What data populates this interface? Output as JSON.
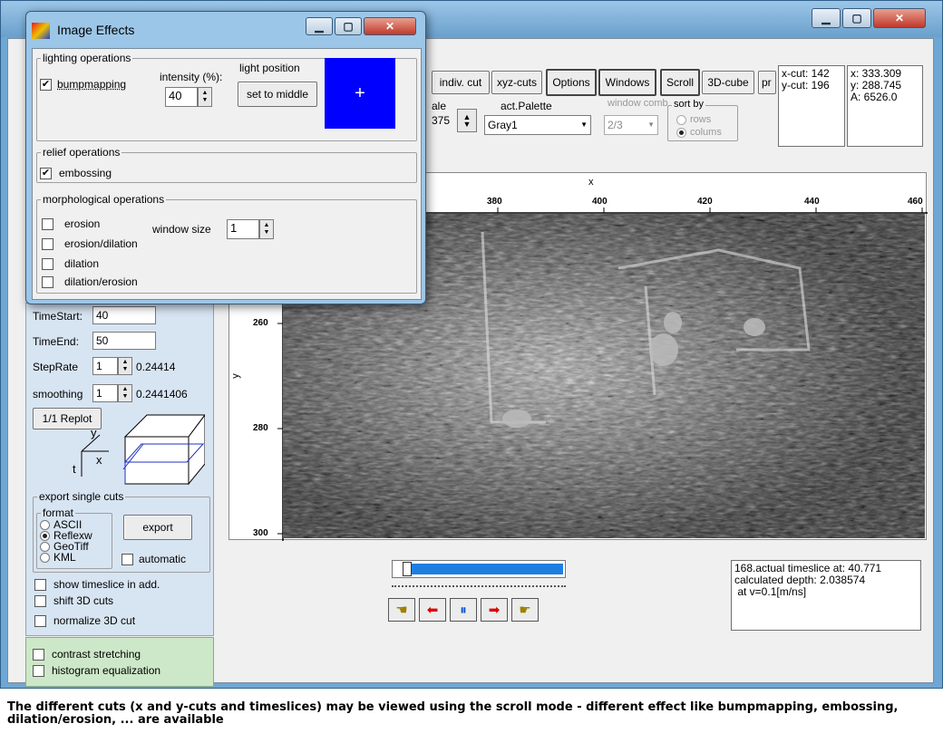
{
  "toolbar": {
    "indiv_cut": "indiv. cut",
    "xyz_cuts": "xyz-cuts",
    "options": "Options",
    "windows": "Windows",
    "scroll": "Scroll",
    "cube3d": "3D-cube",
    "pr_partial": "pr",
    "scale_label_partial": "ale",
    "scale_value_partial": "375",
    "palette_label": "act.Palette",
    "palette_value": "Gray1",
    "window_comb_label": "window comb.",
    "window_comb_value": "2/3",
    "sort_by_label": "sort by",
    "sort_rows": "rows",
    "sort_columns": "colums"
  },
  "info1": "x-cut: 142\ny-cut: 196",
  "info2": "x: 333.309\ny: 288.745\nA: 6526.0",
  "plot": {
    "x_axis_label": "x",
    "y_axis_label": "y",
    "x_ticks": [
      "380",
      "400",
      "420",
      "440",
      "460"
    ],
    "y_ticks": [
      "260",
      "280",
      "300"
    ]
  },
  "left_panel": {
    "time_start_label": "TimeStart:",
    "time_start_value": "40",
    "time_end_label": "TimeEnd:",
    "time_end_value": "50",
    "step_rate_label": "StepRate",
    "step_rate_value": "1",
    "step_rate_extra": "0.24414",
    "smoothing_label": "smoothing",
    "smoothing_value": "1",
    "smoothing_extra": "0.2441406",
    "replot": "1/1 Replot",
    "cube_y": "y",
    "cube_x": "x",
    "cube_t": "t",
    "export_group": "export single cuts",
    "format_group": "format",
    "fmt_ascii": "ASCII",
    "fmt_reflexw": "Reflexw",
    "fmt_geotiff": "GeoTiff",
    "fmt_kml": "KML",
    "export_button": "export",
    "automatic": "automatic",
    "show_timeslice": "show timeslice in add.",
    "shift_3d": "shift 3D cuts",
    "normalize_3d": "normalize 3D cut"
  },
  "green_panel": {
    "contrast": "contrast stretching",
    "histogram": "histogram equalization"
  },
  "status_text": "168.actual timeslice at: 40.771\ncalculated depth: 2.038574\n at v=0.1[m/ns]",
  "slider": {
    "position": 0.05
  },
  "dialog": {
    "title": "Image Effects",
    "lighting_group": "lighting operations",
    "bumpmapping": "bumpmapping",
    "intensity_label": "intensity (%):",
    "intensity_value": "40",
    "light_position_label": "light position",
    "set_to_middle": "set to middle",
    "light_color": "#0000ff",
    "relief_group": "relief operations",
    "embossing": "embossing",
    "morph_group": "morphological operations",
    "erosion": "erosion",
    "window_size_label": "window size",
    "window_size_value": "1",
    "erosion_dilation": "erosion/dilation",
    "dilation": "dilation",
    "dilation_erosion": "dilation/erosion"
  },
  "caption": "The different cuts (x and y-cuts and timeslices) may be viewed using the scroll mode - different effect like bumpmapping, embossing, dilation/erosion, ... are available"
}
